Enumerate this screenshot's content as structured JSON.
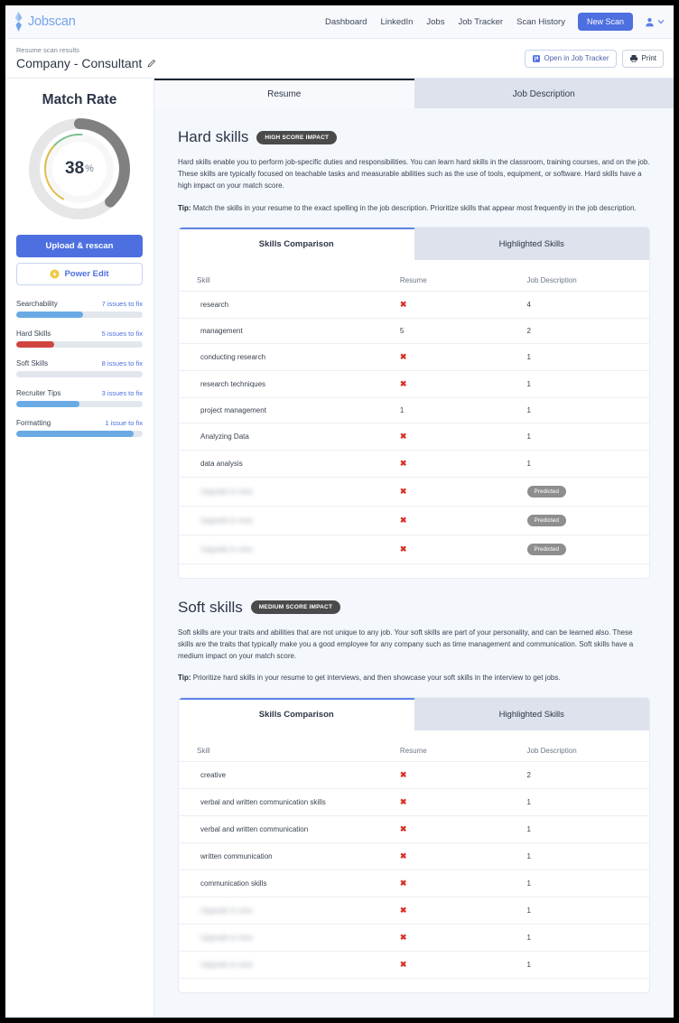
{
  "topnav": {
    "brand": "Jobscan",
    "links": [
      "Dashboard",
      "LinkedIn",
      "Jobs",
      "Job Tracker",
      "Scan History"
    ],
    "new_scan_label": "New Scan",
    "accent_color": "#4d6fe0"
  },
  "subheader": {
    "kicker": "Resume scan results",
    "title": "Company - Consultant",
    "open_tracker_label": "Open in Job Tracker",
    "print_label": "Print"
  },
  "sidebar": {
    "match_title": "Match Rate",
    "match_value": "38",
    "match_unit": "%",
    "upload_label": "Upload & rescan",
    "power_edit_label": "Power Edit",
    "scores": [
      {
        "label": "Searchability",
        "issues": "7 issues to fix",
        "percent": 53,
        "color": "#6aaae4"
      },
      {
        "label": "Hard Skills",
        "issues": "5 issues to fix",
        "percent": 30,
        "color": "#d0453f"
      },
      {
        "label": "Soft Skills",
        "issues": "8 issues to fix",
        "percent": 0,
        "color": "#6aaae4"
      },
      {
        "label": "Recruiter Tips",
        "issues": "3 issues to fix",
        "percent": 50,
        "color": "#6aaae4"
      },
      {
        "label": "Formatting",
        "issues": "1 issue to fix",
        "percent": 93,
        "color": "#6aaae4"
      }
    ]
  },
  "main_tabs": [
    {
      "label": "Resume",
      "active": true
    },
    {
      "label": "Job Description",
      "active": false
    }
  ],
  "sections": [
    {
      "title": "Hard skills",
      "impact": "HIGH SCORE IMPACT",
      "body": "Hard skills enable you to perform job-specific duties and responsibilities. You can learn hard skills in the classroom, training courses, and on the job. These skills are typically focused on teachable tasks and measurable abilities such as the use of tools, equipment, or software. Hard skills have a high impact on your match score.",
      "tip_label": "Tip:",
      "tip": "Match the skills in your resume to the exact spelling in the job description. Prioritize skills that appear most frequently in the job description.",
      "tabs": [
        {
          "label": "Skills Comparison",
          "active": true
        },
        {
          "label": "Highlighted Skills",
          "active": false
        }
      ],
      "columns": [
        "Skill",
        "Resume",
        "Job Description"
      ],
      "rows": [
        {
          "skill": "research",
          "blurred": false,
          "resume": "x",
          "jd": "4",
          "jd_pill": false
        },
        {
          "skill": "management",
          "blurred": false,
          "resume": "5",
          "jd": "2",
          "jd_pill": false
        },
        {
          "skill": "conducting research",
          "blurred": false,
          "resume": "x",
          "jd": "1",
          "jd_pill": false
        },
        {
          "skill": "research techniques",
          "blurred": false,
          "resume": "x",
          "jd": "1",
          "jd_pill": false
        },
        {
          "skill": "project management",
          "blurred": false,
          "resume": "1",
          "jd": "1",
          "jd_pill": false
        },
        {
          "skill": "Analyzing Data",
          "blurred": false,
          "resume": "x",
          "jd": "1",
          "jd_pill": false
        },
        {
          "skill": "data analysis",
          "blurred": false,
          "resume": "x",
          "jd": "1",
          "jd_pill": false
        },
        {
          "skill": "Upgrade to view",
          "blurred": true,
          "resume": "x",
          "jd": "Predicted",
          "jd_pill": true
        },
        {
          "skill": "Upgrade to view",
          "blurred": true,
          "resume": "x",
          "jd": "Predicted",
          "jd_pill": true
        },
        {
          "skill": "Upgrade to view",
          "blurred": true,
          "resume": "x",
          "jd": "Predicted",
          "jd_pill": true
        }
      ]
    },
    {
      "title": "Soft skills",
      "impact": "MEDIUM SCORE IMPACT",
      "body": "Soft skills are your traits and abilities that are not unique to any job. Your soft skills are part of your personality, and can be learned also. These skills are the traits that typically make you a good employee for any company such as time management and communication. Soft skills have a medium impact on your match score.",
      "tip_label": "Tip:",
      "tip": "Prioritize hard skills in your resume to get interviews, and then showcase your soft skills in the interview to get jobs.",
      "tabs": [
        {
          "label": "Skills Comparison",
          "active": true
        },
        {
          "label": "Highlighted Skills",
          "active": false
        }
      ],
      "columns": [
        "Skill",
        "Resume",
        "Job Description"
      ],
      "rows": [
        {
          "skill": "creative",
          "blurred": false,
          "resume": "x",
          "jd": "2",
          "jd_pill": false
        },
        {
          "skill": "verbal and written communication skills",
          "blurred": false,
          "resume": "x",
          "jd": "1",
          "jd_pill": false
        },
        {
          "skill": "verbal and written communication",
          "blurred": false,
          "resume": "x",
          "jd": "1",
          "jd_pill": false
        },
        {
          "skill": "written communication",
          "blurred": false,
          "resume": "x",
          "jd": "1",
          "jd_pill": false
        },
        {
          "skill": "communication skills",
          "blurred": false,
          "resume": "x",
          "jd": "1",
          "jd_pill": false
        },
        {
          "skill": "Upgrade to view",
          "blurred": true,
          "resume": "x",
          "jd": "1",
          "jd_pill": false
        },
        {
          "skill": "Upgrade to view",
          "blurred": true,
          "resume": "x",
          "jd": "1",
          "jd_pill": false
        },
        {
          "skill": "Upgrade to view",
          "blurred": true,
          "resume": "x",
          "jd": "1",
          "jd_pill": false
        }
      ]
    }
  ],
  "icons": {
    "x": "✖"
  }
}
